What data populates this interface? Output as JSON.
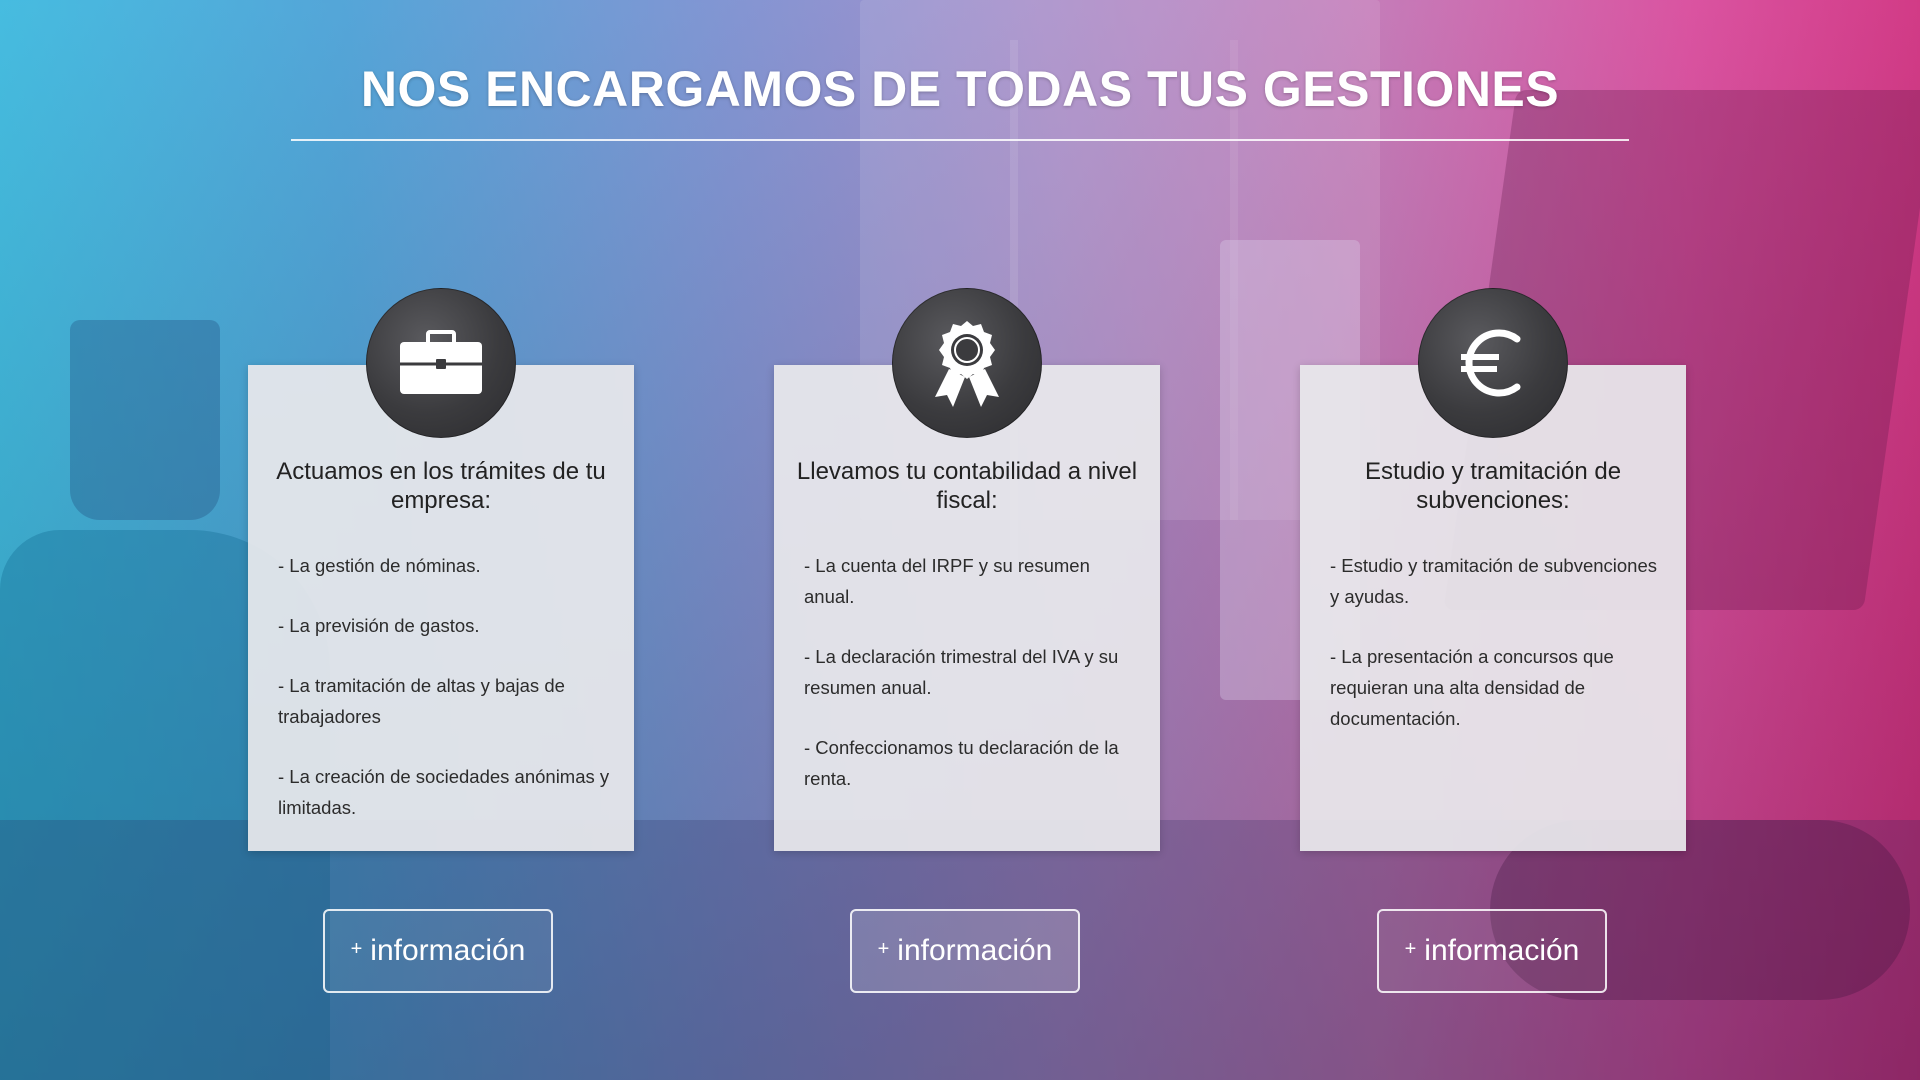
{
  "page": {
    "title": "NOS ENCARGAMOS DE TODAS TUS GESTIONES"
  },
  "cards": [
    {
      "icon": "briefcase-icon",
      "heading": "Actuamos en los trámites de tu empresa:",
      "items": [
        "-  La gestión de nóminas.",
        "-  La previsión de gastos.",
        "-  La tramitación de altas y bajas de trabajadores",
        "- La creación de sociedades anónimas y limitadas."
      ],
      "button": {
        "plus": "+",
        "label": "información"
      }
    },
    {
      "icon": "award-ribbon-icon",
      "heading": "Llevamos tu contabilidad a nivel fiscal:",
      "items": [
        "-  La cuenta del IRPF y su resumen anual.",
        "- La declaración trimestral del IVA y su resumen anual.",
        "- Confeccionamos tu declaración de la renta."
      ],
      "button": {
        "plus": "+",
        "label": "información"
      }
    },
    {
      "icon": "euro-icon",
      "heading": "Estudio y tramitación de subvenciones:",
      "items": [
        "-  Estudio y tramitación de subvenciones y ayudas.",
        "- La presentación a concursos que requieran una alta densidad de documentación."
      ],
      "button": {
        "plus": "+",
        "label": "información"
      }
    }
  ],
  "colors": {
    "gradient_left": "#3bb8de",
    "gradient_mid": "#a487c6",
    "gradient_right": "#cf2f7f",
    "card_bg": "#e8e8ec",
    "icon_circle": "#3b3b3e",
    "text_dark": "#222222",
    "button_border": "#ffffff"
  }
}
